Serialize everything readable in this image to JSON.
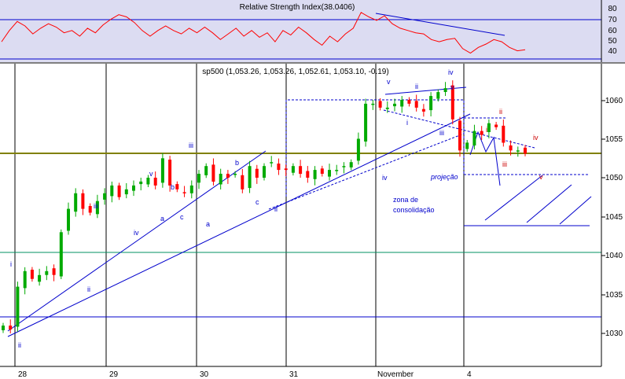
{
  "colors": {
    "background": "#ffffff",
    "rsi_panel_bg": "#dcdcf2",
    "rsi_line": "#ff0000",
    "up_candle": "#00aa00",
    "down_candle": "#ff0000",
    "trendline": "#0000cc",
    "support_line": "#808000",
    "green_level": "#009060",
    "annotation_blue": "#0000cc",
    "annotation_red": "#cc0000"
  },
  "chart_data": [
    {
      "type": "line",
      "title": "Relative Strength Index(38.0406)",
      "ylim": [
        32,
        87
      ],
      "y_ticks": [
        "80",
        "70",
        "60",
        "50",
        "40"
      ],
      "levels": [
        72,
        32
      ],
      "sample_values": [
        50,
        60,
        68,
        64,
        57,
        62,
        66,
        63,
        58,
        60,
        55,
        62,
        58,
        65,
        70,
        74,
        72,
        67,
        60,
        55,
        60,
        64,
        60,
        57,
        62,
        58,
        63,
        58,
        52,
        57,
        62,
        55,
        60,
        54,
        58,
        50,
        60,
        56,
        63,
        58,
        52,
        47,
        55,
        50,
        57,
        62,
        76,
        72,
        69,
        73,
        66,
        62,
        60,
        58,
        57,
        52,
        50,
        52,
        53,
        44,
        40,
        45,
        48,
        52,
        50,
        45,
        42,
        43
      ]
    },
    {
      "type": "candlestick",
      "title": "sp500 (1,053.26, 1,053.26, 1,052.61, 1,053.10, -0.19)",
      "ylim": [
        1026,
        1067
      ],
      "y_ticks": [
        "1060",
        "1055",
        "1050",
        "1045",
        "1040",
        "1035",
        "1030"
      ],
      "x_labels": [
        "28",
        "29",
        "30",
        "31",
        "November",
        "4"
      ],
      "levels": [
        1053.3,
        1040.3,
        1032.1,
        1043.8,
        1050.4
      ],
      "closes": [
        1031.0,
        1030.5,
        1036.0,
        1038.0,
        1037.0,
        1037.5,
        1038.0,
        1037.5,
        1043.0,
        1046.0,
        1048.0,
        1046.0,
        1045.5,
        1047.0,
        1048.0,
        1049.0,
        1047.5,
        1048.5,
        1049.0,
        1049.5,
        1050.0,
        1049.0,
        1052.5,
        1049.0,
        1048.5,
        1048.0,
        1049.0,
        1050.5,
        1051.5,
        1049.5,
        1050.5,
        1050.0,
        1050.5,
        1048.5,
        1051.5,
        1050.0,
        1051.5,
        1052.0,
        1051.0,
        1051.0,
        1051.5,
        1050.5,
        1050.0,
        1051.0,
        1050.5,
        1051.0,
        1051.0,
        1051.5,
        1052.0,
        1055.0,
        1059.5,
        1059.5,
        1059.0,
        1059.0,
        1059.5,
        1060.0,
        1059.5,
        1059.0,
        1058.5,
        1060.5,
        1061.0,
        1061.5,
        1057.5,
        1053.5,
        1054.5,
        1056.0,
        1055.5,
        1057.0,
        1056.5,
        1054.5,
        1053.5,
        1053.5,
        1053.1
      ],
      "wave_labels": [
        "i",
        "ii",
        "iii",
        "iv",
        "v",
        "a",
        "b",
        "c",
        "iii",
        "b",
        "a",
        "c",
        "iii",
        "iv",
        "v",
        "ii",
        "iv",
        "i",
        "iii",
        "iv",
        "v",
        "i",
        "ii",
        "iii",
        "iv",
        "v"
      ],
      "annotations": [
        "projeção",
        "zona de",
        "consolidação"
      ]
    }
  ]
}
